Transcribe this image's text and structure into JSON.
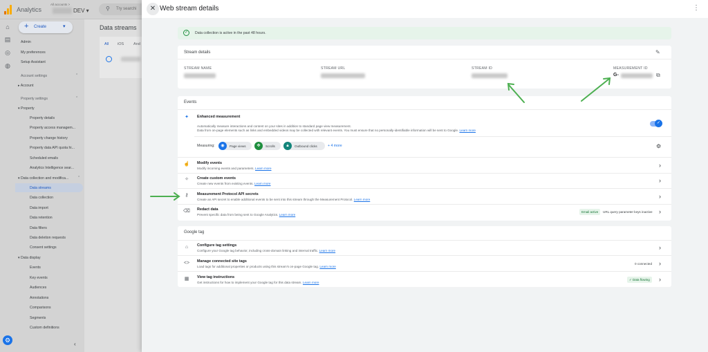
{
  "app": {
    "name": "Analytics",
    "account_small": "All accounts >",
    "account_name": "DEV",
    "search_placeholder": "Try searchi"
  },
  "sidebar": {
    "create_label": "Create",
    "items_top": [
      "Admin",
      "My preferences",
      "Setup Assistant"
    ],
    "account_settings": "Account settings",
    "account": "Account",
    "property_settings": "Property settings",
    "property": "Property",
    "property_items": [
      "Property details",
      "Property access managem...",
      "Property change history",
      "Property data API quota hi...",
      "Scheduled emails",
      "Analytics Intelligence sear..."
    ],
    "data_collection": "Data collection and modifica...",
    "data_collection_items": [
      "Data streams",
      "Data collection",
      "Data import",
      "Data retention",
      "Data filters",
      "Data deletion requests",
      "Consent settings"
    ],
    "data_display": "Data display",
    "data_display_items": [
      "Events",
      "Key events",
      "Audiences",
      "Annotations",
      "Comparisons",
      "Segments",
      "Custom definitions"
    ],
    "active_item": "Data streams"
  },
  "main": {
    "title": "Data streams",
    "tabs": [
      "All",
      "iOS",
      "And"
    ]
  },
  "drawer": {
    "title": "Web stream details",
    "banner": "Data collection is active in the past 48 hours.",
    "stream_details": {
      "title": "Stream details",
      "labels": [
        "STREAM NAME",
        "STREAM URL",
        "STREAM ID",
        "MEASUREMENT ID"
      ],
      "measurement_prefix": "G-"
    },
    "events": {
      "title": "Events",
      "enhanced": {
        "title": "Enhanced measurement",
        "desc1": "Automatically measure interactions and content on your sites in addition to standard page view measurement.",
        "desc2": "Data from on-page elements such as links and embedded videos may be collected with relevant events. You must ensure that no personally-identifiable information will be sent to Google.",
        "learn_more": "Learn more",
        "enabled": true
      },
      "measuring_label": "Measuring:",
      "chips": [
        {
          "label": "Page views",
          "color": "#1a73e8",
          "icon": "eye-icon"
        },
        {
          "label": "Scrolls",
          "color": "#1e8e3e",
          "icon": "crosshair-icon"
        },
        {
          "label": "Outbound clicks",
          "color": "#12857a",
          "icon": "lock-icon"
        }
      ],
      "more": "+ 4 more",
      "rows": [
        {
          "title": "Modify events",
          "desc": "Modify incoming events and parameters.",
          "link": "Learn more",
          "icon": "hand-icon"
        },
        {
          "title": "Create custom events",
          "desc": "Create new events from existing events.",
          "link": "Learn more",
          "icon": "sparkle-icon"
        },
        {
          "title": "Measurement Protocol API secrets",
          "desc": "Create an API secret to enable additional events to be sent into this stream through the Measurement Protocol.",
          "link": "Learn more",
          "icon": "key-icon"
        },
        {
          "title": "Redact data",
          "desc": "Prevent specific data from being sent to Google Analytics.",
          "link": "Learn more",
          "icon": "eraser-icon",
          "badge": "Email active",
          "extra": "URL query parameter keys inactive"
        }
      ]
    },
    "google_tag": {
      "title": "Google tag",
      "rows": [
        {
          "title": "Configure tag settings",
          "desc": "Configure your Google tag behavior, including cross-domain linking and internal traffic.",
          "link": "Learn more",
          "icon": "tag-icon"
        },
        {
          "title": "Manage connected site tags",
          "desc": "Load tags for additional properties or products using this stream's on-page Google tag.",
          "link": "Learn more",
          "icon": "code-icon",
          "extra": "0 connected"
        },
        {
          "title": "View tag instructions",
          "desc": "Get instructions for how to implement your Google tag for this data stream.",
          "link": "Learn more",
          "icon": "instructions-icon",
          "badge": "Data flowing"
        }
      ]
    }
  },
  "colors": {
    "accent": "#1a73e8",
    "success": "#1e8e3e",
    "annotation_arrow": "#4caf50"
  }
}
